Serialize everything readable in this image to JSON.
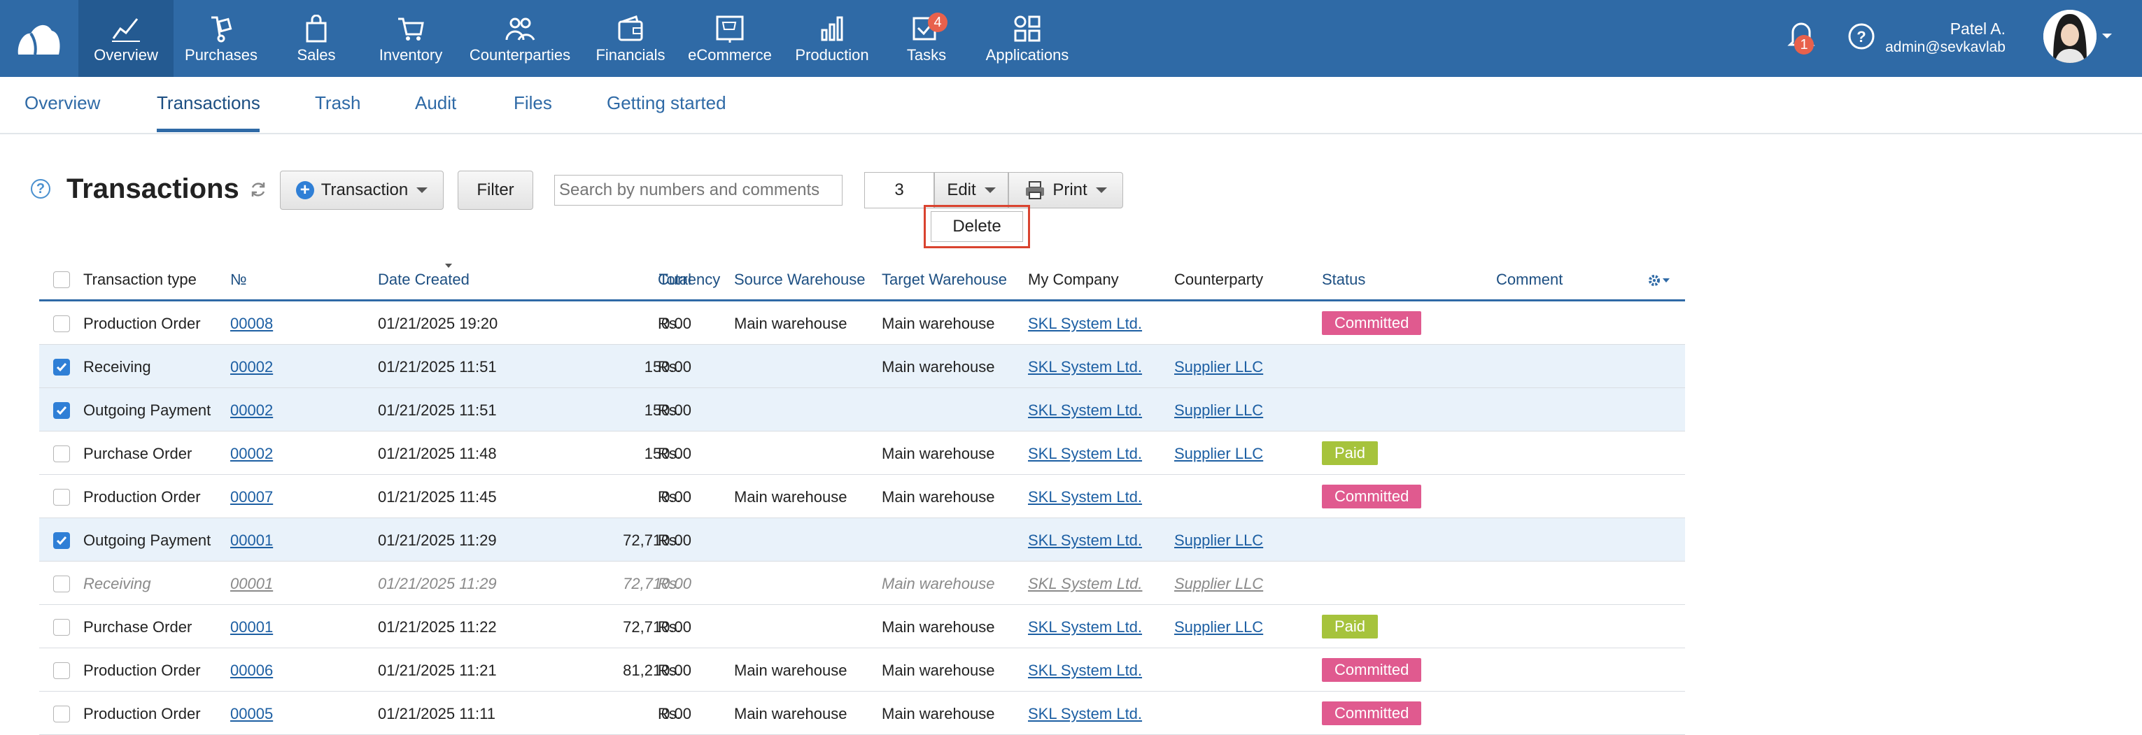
{
  "colors": {
    "nav_bg": "#2f6aa6",
    "accent": "#2f6aa6",
    "committed": "#e05a8f",
    "paid": "#a6c33c",
    "highlight_red": "#d9432f",
    "selected_row": "#e9f2fa"
  },
  "nav": {
    "items": [
      {
        "label": "Overview",
        "icon": "chart-line-icon",
        "active": true
      },
      {
        "label": "Purchases",
        "icon": "hand-truck-icon"
      },
      {
        "label": "Sales",
        "icon": "shopping-bag-icon"
      },
      {
        "label": "Inventory",
        "icon": "cart-icon"
      },
      {
        "label": "Counterparties",
        "icon": "people-icon"
      },
      {
        "label": "Financials",
        "icon": "wallet-icon"
      },
      {
        "label": "eCommerce",
        "icon": "storefront-icon"
      },
      {
        "label": "Production",
        "icon": "bar-chart-icon"
      },
      {
        "label": "Tasks",
        "icon": "checkbox-icon",
        "badge": "4"
      },
      {
        "label": "Applications",
        "icon": "grid-icon"
      }
    ],
    "notifications_badge": "1",
    "user_name": "Patel A.",
    "user_email": "admin@sevkavlab"
  },
  "subtabs": [
    "Overview",
    "Transactions",
    "Trash",
    "Audit",
    "Files",
    "Getting started"
  ],
  "toolbar": {
    "title": "Transactions",
    "help": "?",
    "transaction_button": "Transaction",
    "filter_button": "Filter",
    "search_placeholder": "Search by numbers and comments",
    "selected_count": "3",
    "edit_button": "Edit",
    "print_button": "Print",
    "delete_button": "Delete"
  },
  "table": {
    "headers": [
      "Transaction type",
      "№",
      "Date Created",
      "Total",
      "Currency",
      "Source Warehouse",
      "Target Warehouse",
      "My Company",
      "Counterparty",
      "Status",
      "Comment"
    ],
    "rows": [
      {
        "type": "Production Order",
        "number": "00008",
        "date": "01/21/2025 19:20",
        "total": "0.00",
        "currency": "Rs.",
        "source": "Main warehouse",
        "target": "Main warehouse",
        "company": "SKL System Ltd.",
        "counterparty": "",
        "status": "Committed"
      },
      {
        "type": "Receiving",
        "number": "00002",
        "date": "01/21/2025 11:51",
        "total": "150.00",
        "currency": "Rs.",
        "source": "",
        "target": "Main warehouse",
        "company": "SKL System Ltd.",
        "counterparty": "Supplier LLC",
        "status": ""
      },
      {
        "type": "Outgoing Payment",
        "number": "00002",
        "date": "01/21/2025 11:51",
        "total": "150.00",
        "currency": "Rs.",
        "source": "",
        "target": "",
        "company": "SKL System Ltd.",
        "counterparty": "Supplier LLC",
        "status": ""
      },
      {
        "type": "Purchase Order",
        "number": "00002",
        "date": "01/21/2025 11:48",
        "total": "150.00",
        "currency": "Rs.",
        "source": "",
        "target": "Main warehouse",
        "company": "SKL System Ltd.",
        "counterparty": "Supplier LLC",
        "status": "Paid"
      },
      {
        "type": "Production Order",
        "number": "00007",
        "date": "01/21/2025 11:45",
        "total": "0.00",
        "currency": "Rs.",
        "source": "Main warehouse",
        "target": "Main warehouse",
        "company": "SKL System Ltd.",
        "counterparty": "",
        "status": "Committed"
      },
      {
        "type": "Outgoing Payment",
        "number": "00001",
        "date": "01/21/2025 11:29",
        "total": "72,710.00",
        "currency": "Rs.",
        "source": "",
        "target": "",
        "company": "SKL System Ltd.",
        "counterparty": "Supplier LLC",
        "status": ""
      },
      {
        "type": "Receiving",
        "number": "00001",
        "date": "01/21/2025 11:29",
        "total": "72,710.00",
        "currency": "Rs.",
        "source": "",
        "target": "Main warehouse",
        "company": "SKL System Ltd.",
        "counterparty": "Supplier LLC",
        "status": ""
      },
      {
        "type": "Purchase Order",
        "number": "00001",
        "date": "01/21/2025 11:22",
        "total": "72,710.00",
        "currency": "Rs.",
        "source": "",
        "target": "Main warehouse",
        "company": "SKL System Ltd.",
        "counterparty": "Supplier LLC",
        "status": "Paid"
      },
      {
        "type": "Production Order",
        "number": "00006",
        "date": "01/21/2025 11:21",
        "total": "81,210.00",
        "currency": "Rs.",
        "source": "Main warehouse",
        "target": "Main warehouse",
        "company": "SKL System Ltd.",
        "counterparty": "",
        "status": "Committed"
      },
      {
        "type": "Production Order",
        "number": "00005",
        "date": "01/21/2025 11:11",
        "total": "0.00",
        "currency": "Rs.",
        "source": "Main warehouse",
        "target": "Main warehouse",
        "company": "SKL System Ltd.",
        "counterparty": "",
        "status": "Committed"
      }
    ]
  }
}
